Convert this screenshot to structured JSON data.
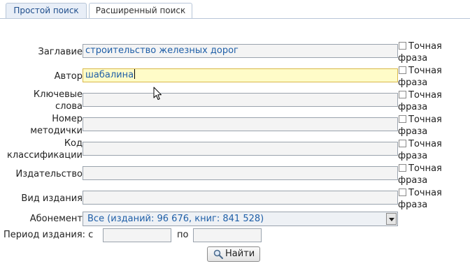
{
  "tabs": [
    {
      "label": "Простой поиск",
      "active": true
    },
    {
      "label": "Расширенный поиск",
      "active": false
    }
  ],
  "form": {
    "title": {
      "label": "Заглавие",
      "value": "строительство железных дорог"
    },
    "author": {
      "label": "Автор",
      "value": "шабалина"
    },
    "keywords": {
      "label": "Ключевые\nслова",
      "value": ""
    },
    "manual_number": {
      "label": "Номер\nметодички",
      "value": ""
    },
    "classification": {
      "label": "Код\nклассификации",
      "value": ""
    },
    "publisher": {
      "label": "Издательство",
      "value": ""
    },
    "edition_type": {
      "label": "Вид издания",
      "value": ""
    },
    "exact_phrase": {
      "line1": "Точная",
      "line2": "фраза"
    },
    "subscription": {
      "label": "Абонемент",
      "selected": "Все (изданий: 96 676, книг: 841 528)"
    },
    "period": {
      "label": "Период издания: с",
      "to_label": "по",
      "from": "",
      "to": ""
    },
    "search_button": "Найти"
  },
  "colors": {
    "accent": "#1f5fa8",
    "focused_field": "#fffcc8",
    "field_bg": "#f4f4f4"
  }
}
